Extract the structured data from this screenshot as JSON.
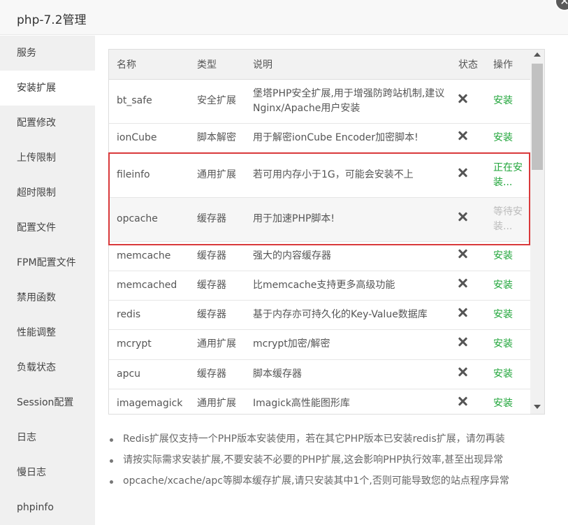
{
  "window": {
    "title": "php-7.2管理",
    "close_symbol": "✕"
  },
  "sidebar": {
    "items": [
      {
        "label": "服务"
      },
      {
        "label": "安装扩展",
        "active": true
      },
      {
        "label": "配置修改"
      },
      {
        "label": "上传限制"
      },
      {
        "label": "超时限制"
      },
      {
        "label": "配置文件"
      },
      {
        "label": "FPM配置文件"
      },
      {
        "label": "禁用函数"
      },
      {
        "label": "性能调整"
      },
      {
        "label": "负载状态"
      },
      {
        "label": "Session配置"
      },
      {
        "label": "日志"
      },
      {
        "label": "慢日志"
      },
      {
        "label": "phpinfo"
      }
    ]
  },
  "table": {
    "headers": {
      "name": "名称",
      "type": "类型",
      "desc": "说明",
      "status": "状态",
      "action": "操作"
    },
    "rows": [
      {
        "name": "bt_safe",
        "type": "安全扩展",
        "desc": "堡塔PHP安全扩展,用于增强防跨站机制,建议Nginx/Apache用户安装",
        "status": "not-installed",
        "action": "安装"
      },
      {
        "name": "ionCube",
        "type": "脚本解密",
        "desc": "用于解密ionCube Encoder加密脚本!",
        "status": "not-installed",
        "action": "安装"
      },
      {
        "name": "fileinfo",
        "type": "通用扩展",
        "desc": "若可用内存小于1G，可能会安装不上",
        "status": "not-installed",
        "action": "正在安装..."
      },
      {
        "name": "opcache",
        "type": "缓存器",
        "desc": "用于加速PHP脚本!",
        "status": "not-installed",
        "action": "等待安装..."
      },
      {
        "name": "memcache",
        "type": "缓存器",
        "desc": "强大的内容缓存器",
        "status": "not-installed",
        "action": "安装"
      },
      {
        "name": "memcached",
        "type": "缓存器",
        "desc": "比memcache支持更多高级功能",
        "status": "not-installed",
        "action": "安装"
      },
      {
        "name": "redis",
        "type": "缓存器",
        "desc": "基于内存亦可持久化的Key-Value数据库",
        "status": "not-installed",
        "action": "安装"
      },
      {
        "name": "mcrypt",
        "type": "通用扩展",
        "desc": "mcrypt加密/解密",
        "status": "not-installed",
        "action": "安装"
      },
      {
        "name": "apcu",
        "type": "缓存器",
        "desc": "脚本缓存器",
        "status": "not-installed",
        "action": "安装"
      },
      {
        "name": "imagemagick",
        "type": "通用扩展",
        "desc": "Imagick高性能图形库",
        "status": "not-installed",
        "action": "安装"
      }
    ]
  },
  "notes": [
    "Redis扩展仅支持一个PHP版本安装使用，若在其它PHP版本已安装redis扩展，请勿再装",
    "请按实际需求安装扩展,不要安装不必要的PHP扩展,这会影响PHP执行效率,甚至出现异常",
    "opcache/xcache/apc等脚本缓存扩展,请只安装其中1个,否则可能导致您的站点程序异常"
  ],
  "colors": {
    "install": "#20a53a",
    "waiting": "#bbbbbb",
    "highlight_border": "#d9393b"
  }
}
